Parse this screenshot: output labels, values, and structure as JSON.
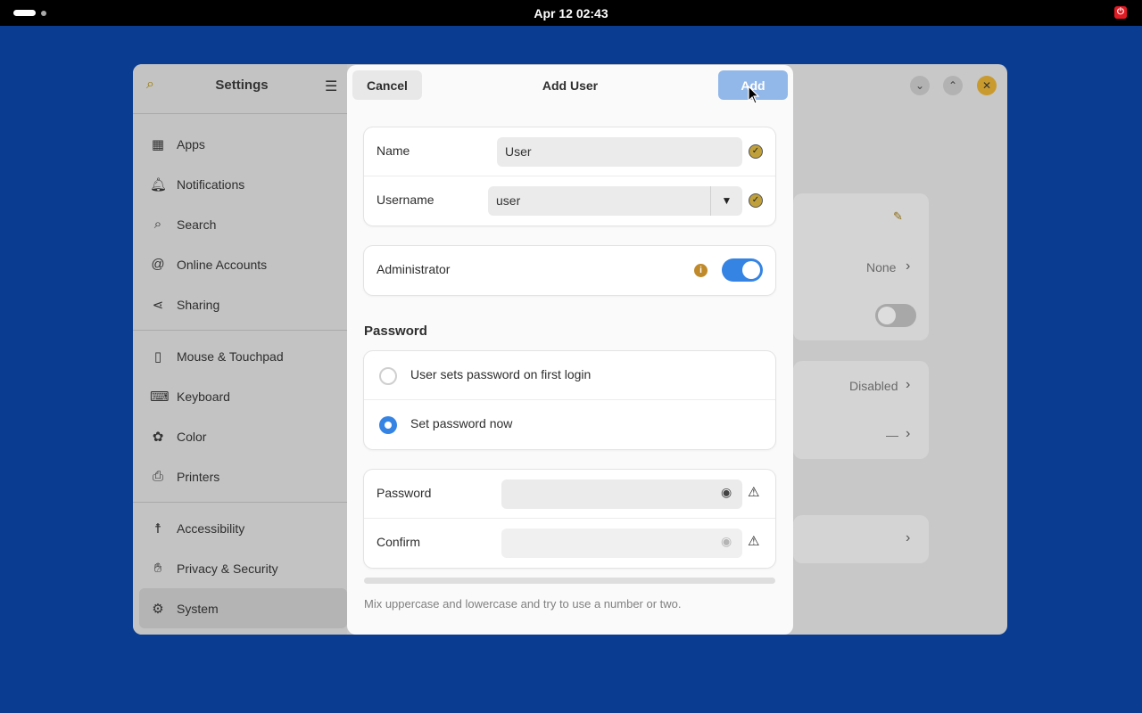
{
  "topbar": {
    "clock": "Apr 12  02:43",
    "power_icon": "power-icon"
  },
  "settings": {
    "title": "Settings",
    "nav": [
      {
        "label": "Apps",
        "icon": "apps-icon",
        "glyph": "▦"
      },
      {
        "label": "Notifications",
        "icon": "bell-icon",
        "glyph": "🔔︎"
      },
      {
        "label": "Search",
        "icon": "search-icon",
        "glyph": "⌕"
      },
      {
        "label": "Online Accounts",
        "icon": "at-icon",
        "glyph": "@"
      },
      {
        "label": "Sharing",
        "icon": "share-icon",
        "glyph": "⋖"
      },
      {
        "label": "Mouse & Touchpad",
        "icon": "mouse-icon",
        "glyph": "▯"
      },
      {
        "label": "Keyboard",
        "icon": "keyboard-icon",
        "glyph": "⌨"
      },
      {
        "label": "Color",
        "icon": "color-icon",
        "glyph": "✿"
      },
      {
        "label": "Printers",
        "icon": "printer-icon",
        "glyph": "⎙"
      },
      {
        "label": "Accessibility",
        "icon": "accessibility-icon",
        "glyph": "☨"
      },
      {
        "label": "Privacy & Security",
        "icon": "hand-icon",
        "glyph": "✋︎"
      },
      {
        "label": "System",
        "icon": "gear-icon",
        "glyph": "⚙"
      }
    ],
    "background_rows": {
      "language_value": "None",
      "login_value": "Disabled",
      "last_value": "—"
    }
  },
  "dialog": {
    "title": "Add User",
    "cancel_label": "Cancel",
    "add_label": "Add",
    "name_label": "Name",
    "name_value": "User",
    "username_label": "Username",
    "username_value": "user",
    "admin_label": "Administrator",
    "admin_enabled": true,
    "password_section": "Password",
    "radio_first_login": "User sets password on first login",
    "radio_set_now": "Set password now",
    "password_label": "Password",
    "confirm_label": "Confirm",
    "hint": "Mix uppercase and lowercase and try to use a number or two."
  },
  "colors": {
    "desktop": "#0a3d91",
    "accent": "#3584e4",
    "add_button": "#92b8ea"
  }
}
